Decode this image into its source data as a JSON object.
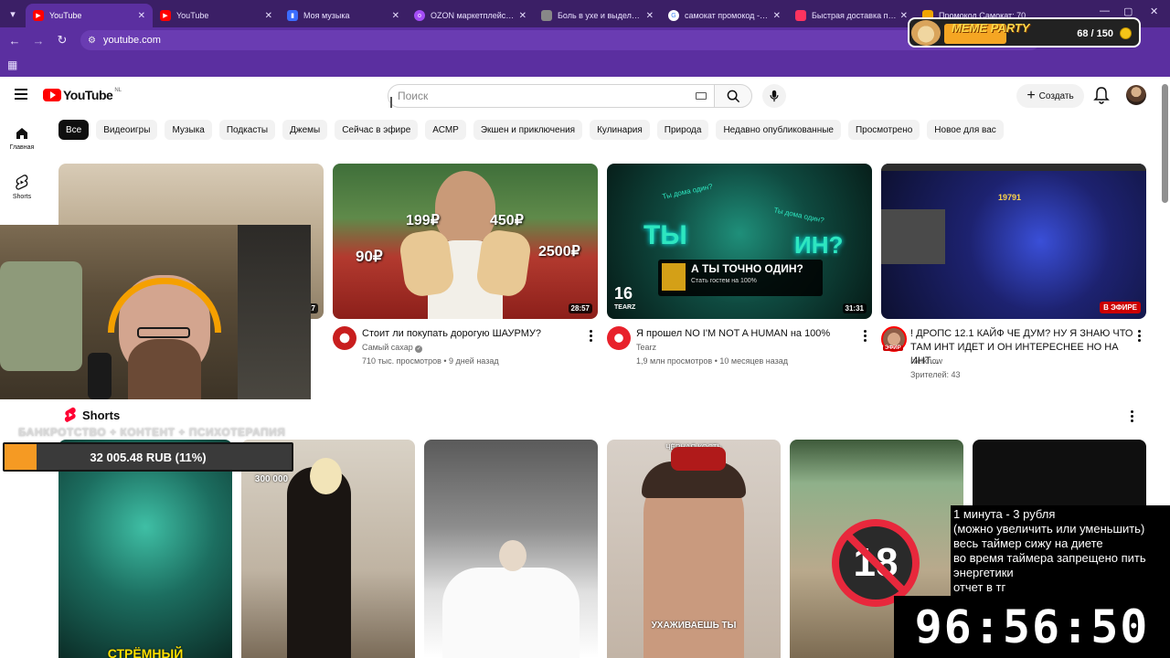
{
  "browser": {
    "tabs": [
      {
        "label": "YouTube",
        "favicon": "youtube",
        "color": "#ff0000",
        "active": true
      },
      {
        "label": "YouTube",
        "favicon": "youtube",
        "color": "#ff0000",
        "active": false
      },
      {
        "label": "Моя музыка",
        "favicon": "music",
        "color": "#3b6cff",
        "active": false
      },
      {
        "label": "OZON маркетплейс – ми",
        "favicon": "ozon",
        "color": "#a44df7",
        "active": false
      },
      {
        "label": "Боль в ухе и выделения",
        "favicon": "doc",
        "color": "#888888",
        "active": false
      },
      {
        "label": "самокат промокод - Пои",
        "favicon": "google",
        "color": "#34a853",
        "active": false
      },
      {
        "label": "Быстрая доставка прод",
        "favicon": "samokat",
        "color": "#ff335f",
        "active": false
      },
      {
        "label": "Промокод Самокат: 70",
        "favicon": "promo",
        "color": "#f0a500",
        "active": false
      }
    ],
    "url": "youtube.com"
  },
  "youtube": {
    "logo_text": "YouTube",
    "region": "NL",
    "search_placeholder": "Поиск",
    "create_label": "Создать",
    "nav": [
      {
        "label": "Главная",
        "icon": "home-icon"
      },
      {
        "label": "Shorts",
        "icon": "shorts-icon"
      }
    ],
    "chips": [
      "Все",
      "Видеоигры",
      "Музыка",
      "Подкасты",
      "Джемы",
      "Сейчас в эфире",
      "АСМР",
      "Экшен и приключения",
      "Кулинария",
      "Природа",
      "Недавно опубликованные",
      "Просмотрено",
      "Новое для вас"
    ],
    "videos": [
      {
        "title": "",
        "channel": "",
        "stats": "",
        "duration": "27"
      },
      {
        "title": "Стоит ли покупать дорогую ШАУРМУ?",
        "channel": "Самый сахар",
        "stats": "710 тыс. просмотров • 9 дней назад",
        "duration": "28:57",
        "thumb_text": [
          "199₽",
          "450₽",
          "90₽",
          "2500₽"
        ]
      },
      {
        "title": "Я прошел NO I'M NOT A HUMAN на 100%",
        "channel": "Tearz",
        "stats": "1,9 млн просмотров • 10 месяцев назад",
        "duration": "31:31",
        "thumb_text": [
          "ТЫ",
          "ИН?",
          "А ТЫ ТОЧНО ОДИН?",
          "Стать гостем на 100%",
          "16",
          "TEARZ",
          "Ты дома один?",
          "Ты дома один?"
        ]
      },
      {
        "title": "! ДРОПС 12.1 КАЙФ ЧЕ ДУМ? НУ Я ЗНАЮ ЧТО ТАМ ИНТ ИДЕТ И ОН ИНТЕРЕСНЕЕ НО НА ИНТ...",
        "channel": "Ivelknow",
        "stats": "Зрителей: 43",
        "live_label": "В ЭФИРЕ",
        "live_avatar_badge": "ЭФИР",
        "thumb_text": [
          "19791"
        ]
      }
    ],
    "shorts_title": "Shorts",
    "shorts": [
      {
        "text": "СТРЁМНЫЙ"
      },
      {
        "text": "300 000"
      },
      {
        "text": ""
      },
      {
        "text_top": "ЧЁРНАЯ КОСТЬ",
        "text": "УХАЖИВАЕШЬ ТЫ"
      },
      {
        "text": ""
      },
      {
        "text": ""
      }
    ]
  },
  "stream": {
    "caption": "БАНКРОТСТВО + КОНТЕНТ + ПСИХОТЕРАПИЯ",
    "progress_text": "32 005.48 RUB (11%)",
    "progress_percent": 11,
    "meme_label": "MEME PARTY",
    "meme_count": "68 / 150",
    "meme_progress": 0.45,
    "info_lines": [
      "1 минута - 3 рубля",
      "(можно увеличить или уменьшить)",
      "весь таймер сижу на диете",
      "во время таймера запрещено пить",
      "энергетики",
      "отчет в тг"
    ],
    "timer": "96:56:50",
    "badge_18": "18"
  },
  "colors": {
    "youtube_red": "#ff0000",
    "browser_purple": "#5b2fa0",
    "tabbar_purple": "#3b1f66",
    "progress_orange": "#f59a23"
  }
}
